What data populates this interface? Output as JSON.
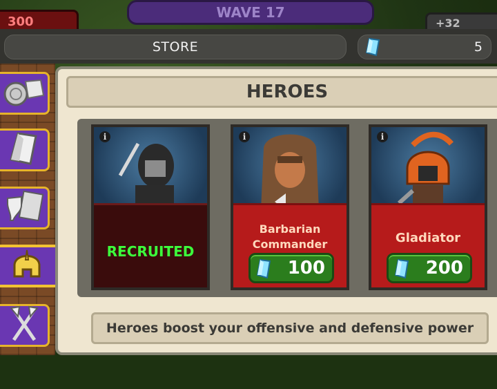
{
  "hud": {
    "left_value": "300",
    "wave_label": "WAVE 17",
    "right_value": "+32"
  },
  "store": {
    "title": "STORE",
    "gem_count": "5",
    "gem_icon": "gem-icon"
  },
  "tabs": [
    {
      "name": "coins",
      "icon": "coins-icon",
      "active": false
    },
    {
      "name": "gems",
      "icon": "gem-icon",
      "active": false
    },
    {
      "name": "items",
      "icon": "items-icon",
      "active": false
    },
    {
      "name": "heroes",
      "icon": "helmet-icon",
      "active": true
    },
    {
      "name": "weapons",
      "icon": "crossed-axes-icon",
      "active": false
    }
  ],
  "section_title": "HEROES",
  "heroes": [
    {
      "name": "",
      "status": "RECRUITED",
      "price": null
    },
    {
      "name_line1": "Barbarian",
      "name_line2": "Commander",
      "price": "100"
    },
    {
      "name_line1": "Gladiator",
      "price": "200"
    }
  ],
  "footer_text": "Heroes boost your offensive and defensive power",
  "colors": {
    "tab_purple": "#6a37b2",
    "tab_border": "#e6b42a",
    "recruited_green": "#3cff3c",
    "price_green": "#2b7d1d",
    "card_red": "#b61b1b",
    "card_dark": "#3a0c0c"
  }
}
